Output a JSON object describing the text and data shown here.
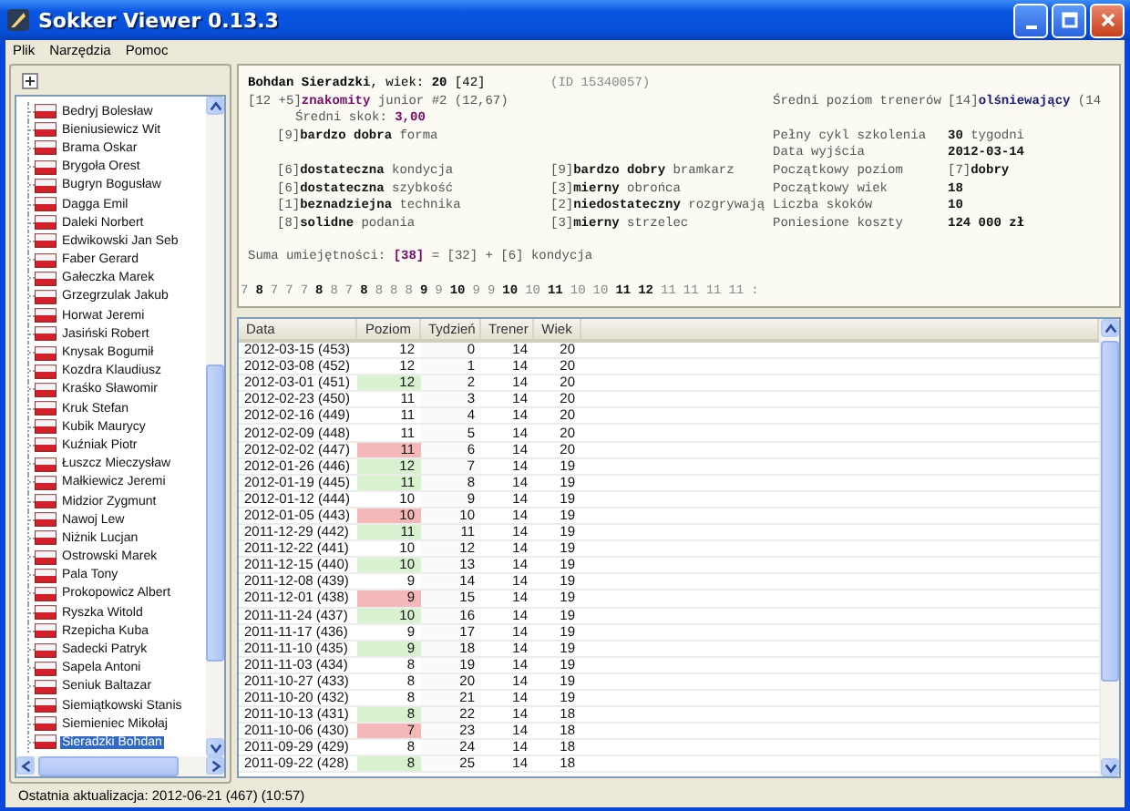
{
  "window": {
    "title": "Sokker Viewer 0.13.3"
  },
  "menu": [
    "Plik",
    "Narzędzia",
    "Pomoc"
  ],
  "tree": {
    "items": [
      {
        "label": "Bedryj Bolesław",
        "selected": false
      },
      {
        "label": "Bieniusiewicz Wit",
        "selected": false
      },
      {
        "label": "Brama Oskar",
        "selected": false
      },
      {
        "label": "Brygoła Orest",
        "selected": false
      },
      {
        "label": "Bugryn Bogusław",
        "selected": false
      },
      {
        "label": "Dagga Emil",
        "selected": false
      },
      {
        "label": "Daleki Norbert",
        "selected": false
      },
      {
        "label": "Edwikowski Jan Seb",
        "selected": false
      },
      {
        "label": "Faber Gerard",
        "selected": false
      },
      {
        "label": "Gałeczka Marek",
        "selected": false
      },
      {
        "label": "Grzegrzulak Jakub",
        "selected": false
      },
      {
        "label": "Horwat Jeremi",
        "selected": false
      },
      {
        "label": "Jasiński Robert",
        "selected": false
      },
      {
        "label": "Knysak Bogumił",
        "selected": false
      },
      {
        "label": "Kozdra Klaudiusz",
        "selected": false
      },
      {
        "label": "Kraśko Sławomir",
        "selected": false
      },
      {
        "label": "Kruk Stefan",
        "selected": false
      },
      {
        "label": "Kubik Maurycy",
        "selected": false
      },
      {
        "label": "Kuźniak Piotr",
        "selected": false
      },
      {
        "label": "Łuszcz Mieczysław",
        "selected": false
      },
      {
        "label": "Małkiewicz Jeremi",
        "selected": false
      },
      {
        "label": "Midzior Zygmunt",
        "selected": false
      },
      {
        "label": "Nawoj Lew",
        "selected": false
      },
      {
        "label": "Niżnik Lucjan",
        "selected": false
      },
      {
        "label": "Ostrowski Marek",
        "selected": false
      },
      {
        "label": "Pala Tony",
        "selected": false
      },
      {
        "label": "Prokopowicz Albert",
        "selected": false
      },
      {
        "label": "Ryszka Witold",
        "selected": false
      },
      {
        "label": "Rzepicha Kuba",
        "selected": false
      },
      {
        "label": "Sadecki Patryk",
        "selected": false
      },
      {
        "label": "Sapela Antoni",
        "selected": false
      },
      {
        "label": "Seniuk Baltazar",
        "selected": false
      },
      {
        "label": "Siemiątkowski Stanis",
        "selected": false
      },
      {
        "label": "Siemieniec Mikołaj",
        "selected": false
      },
      {
        "label": "Sieradzki Bohdan",
        "selected": true
      }
    ]
  },
  "player_card": {
    "header": "**Bohdan Sieradzki**, wiek: **20** [42]",
    "id": "(ID 15340057)",
    "talent": {
      "text": "[12 +5]**znakomity** junior #2 (12,67)",
      "accent": true
    },
    "average_jump": {
      "text": "Średni skok: **3,00**",
      "accent": true
    },
    "form": "[9]**bardzo dobra** forma",
    "skills": [
      "[6]**dostateczna** kondycja",
      "[9]**bardzo dobry** bramkarz",
      "[6]**dostateczna** szybkość",
      "[3]**mierny** obrońca",
      "[1]**beznadziejna** technika",
      "[2]**niedostateczny** rozgrywają",
      "[8]**solidne** podania",
      "[3]**mierny** strzelec"
    ],
    "training_info": [
      {
        "label": "Średni poziom trenerów",
        "value": "[14]**olśniewający** (14",
        "accent": true
      },
      {
        "label": "Pełny cykl szkolenia",
        "value": "**30** tygodni",
        "accent": false
      },
      {
        "label": "Data wyjścia",
        "value": "**2012-03-14**",
        "accent": false
      },
      {
        "label": "Początkowy poziom",
        "value": "[7]**dobry**",
        "accent": false
      },
      {
        "label": "Początkowy wiek",
        "value": "**18**",
        "accent": false
      },
      {
        "label": "Liczba skoków",
        "value": "**10**",
        "accent": false
      },
      {
        "label": "Poniesione koszty",
        "value": "**124 000 zł**",
        "accent": false
      }
    ],
    "skill_sum": {
      "text": "Suma umiejętności: **[38]** = [32] + [6] kondycja",
      "accent": true
    },
    "level_history": [
      {
        "value": "7",
        "bold": false
      },
      {
        "value": "8",
        "bold": true
      },
      {
        "value": "7",
        "bold": false
      },
      {
        "value": "7",
        "bold": false
      },
      {
        "value": "7",
        "bold": false
      },
      {
        "value": "8",
        "bold": true
      },
      {
        "value": "8",
        "bold": false
      },
      {
        "value": "7",
        "bold": false
      },
      {
        "value": "8",
        "bold": true
      },
      {
        "value": "8",
        "bold": false
      },
      {
        "value": "8",
        "bold": false
      },
      {
        "value": "8",
        "bold": false
      },
      {
        "value": "9",
        "bold": true
      },
      {
        "value": "9",
        "bold": false
      },
      {
        "value": "10",
        "bold": true
      },
      {
        "value": "9",
        "bold": false
      },
      {
        "value": "9",
        "bold": false
      },
      {
        "value": "10",
        "bold": true
      },
      {
        "value": "10",
        "bold": false
      },
      {
        "value": "11",
        "bold": true
      },
      {
        "value": "10",
        "bold": false
      },
      {
        "value": "10",
        "bold": false
      },
      {
        "value": "11",
        "bold": true
      },
      {
        "value": "12",
        "bold": true
      },
      {
        "value": "11",
        "bold": false
      },
      {
        "value": "11",
        "bold": false
      },
      {
        "value": "11",
        "bold": false
      },
      {
        "value": "11",
        "bold": false
      },
      {
        "value": ":",
        "bold": false
      }
    ]
  },
  "table": {
    "columns": [
      "Data",
      "Poziom",
      "Tydzień",
      "Trener",
      "Wiek"
    ],
    "rows": [
      {
        "date": "2012-03-15 (453)",
        "level": "12",
        "rose": false,
        "fell": false,
        "week": "0",
        "trainer": "14",
        "age": "20"
      },
      {
        "date": "2012-03-08 (452)",
        "level": "12",
        "rose": false,
        "fell": false,
        "week": "1",
        "trainer": "14",
        "age": "20"
      },
      {
        "date": "2012-03-01 (451)",
        "level": "12",
        "rose": true,
        "fell": false,
        "week": "2",
        "trainer": "14",
        "age": "20"
      },
      {
        "date": "2012-02-23 (450)",
        "level": "11",
        "rose": false,
        "fell": false,
        "week": "3",
        "trainer": "14",
        "age": "20"
      },
      {
        "date": "2012-02-16 (449)",
        "level": "11",
        "rose": false,
        "fell": false,
        "week": "4",
        "trainer": "14",
        "age": "20"
      },
      {
        "date": "2012-02-09 (448)",
        "level": "11",
        "rose": false,
        "fell": false,
        "week": "5",
        "trainer": "14",
        "age": "20"
      },
      {
        "date": "2012-02-02 (447)",
        "level": "11",
        "rose": false,
        "fell": true,
        "week": "6",
        "trainer": "14",
        "age": "20"
      },
      {
        "date": "2012-01-26 (446)",
        "level": "12",
        "rose": true,
        "fell": false,
        "week": "7",
        "trainer": "14",
        "age": "19"
      },
      {
        "date": "2012-01-19 (445)",
        "level": "11",
        "rose": true,
        "fell": false,
        "week": "8",
        "trainer": "14",
        "age": "19"
      },
      {
        "date": "2012-01-12 (444)",
        "level": "10",
        "rose": false,
        "fell": false,
        "week": "9",
        "trainer": "14",
        "age": "19"
      },
      {
        "date": "2012-01-05 (443)",
        "level": "10",
        "rose": false,
        "fell": true,
        "week": "10",
        "trainer": "14",
        "age": "19"
      },
      {
        "date": "2011-12-29 (442)",
        "level": "11",
        "rose": true,
        "fell": false,
        "week": "11",
        "trainer": "14",
        "age": "19"
      },
      {
        "date": "2011-12-22 (441)",
        "level": "10",
        "rose": false,
        "fell": false,
        "week": "12",
        "trainer": "14",
        "age": "19"
      },
      {
        "date": "2011-12-15 (440)",
        "level": "10",
        "rose": true,
        "fell": false,
        "week": "13",
        "trainer": "14",
        "age": "19"
      },
      {
        "date": "2011-12-08 (439)",
        "level": "9",
        "rose": false,
        "fell": false,
        "week": "14",
        "trainer": "14",
        "age": "19"
      },
      {
        "date": "2011-12-01 (438)",
        "level": "9",
        "rose": false,
        "fell": true,
        "week": "15",
        "trainer": "14",
        "age": "19"
      },
      {
        "date": "2011-11-24 (437)",
        "level": "10",
        "rose": true,
        "fell": false,
        "week": "16",
        "trainer": "14",
        "age": "19"
      },
      {
        "date": "2011-11-17 (436)",
        "level": "9",
        "rose": false,
        "fell": false,
        "week": "17",
        "trainer": "14",
        "age": "19"
      },
      {
        "date": "2011-11-10 (435)",
        "level": "9",
        "rose": true,
        "fell": false,
        "week": "18",
        "trainer": "14",
        "age": "19"
      },
      {
        "date": "2011-11-03 (434)",
        "level": "8",
        "rose": false,
        "fell": false,
        "week": "19",
        "trainer": "14",
        "age": "19"
      },
      {
        "date": "2011-10-27 (433)",
        "level": "8",
        "rose": false,
        "fell": false,
        "week": "20",
        "trainer": "14",
        "age": "19"
      },
      {
        "date": "2011-10-20 (432)",
        "level": "8",
        "rose": false,
        "fell": false,
        "week": "21",
        "trainer": "14",
        "age": "19"
      },
      {
        "date": "2011-10-13 (431)",
        "level": "8",
        "rose": true,
        "fell": false,
        "week": "22",
        "trainer": "14",
        "age": "18"
      },
      {
        "date": "2011-10-06 (430)",
        "level": "7",
        "rose": false,
        "fell": true,
        "week": "23",
        "trainer": "14",
        "age": "18"
      },
      {
        "date": "2011-09-29 (429)",
        "level": "8",
        "rose": false,
        "fell": false,
        "week": "24",
        "trainer": "14",
        "age": "18"
      },
      {
        "date": "2011-09-22 (428)",
        "level": "8",
        "rose": true,
        "fell": false,
        "week": "25",
        "trainer": "14",
        "age": "18"
      }
    ]
  },
  "status_bar": {
    "text": "Ostatnia aktualizacja: 2012-06-21 (467) (10:57)"
  }
}
